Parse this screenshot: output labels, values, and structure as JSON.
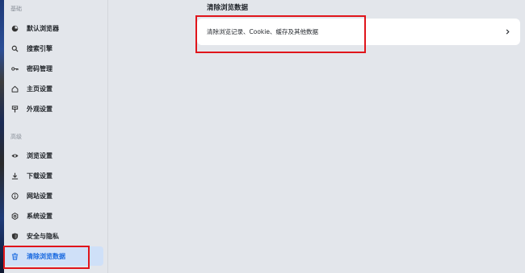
{
  "sidebar": {
    "sections": [
      {
        "title": "基础",
        "items": [
          {
            "label": "默认浏览器",
            "icon": "browser-icon"
          },
          {
            "label": "搜索引擎",
            "icon": "search-icon"
          },
          {
            "label": "密码管理",
            "icon": "key-icon"
          },
          {
            "label": "主页设置",
            "icon": "home-icon"
          },
          {
            "label": "外观设置",
            "icon": "appearance-icon"
          }
        ]
      },
      {
        "title": "高级",
        "items": [
          {
            "label": "浏览设置",
            "icon": "eye-icon"
          },
          {
            "label": "下载设置",
            "icon": "download-icon"
          },
          {
            "label": "网站设置",
            "icon": "info-icon"
          },
          {
            "label": "系统设置",
            "icon": "gear-icon"
          },
          {
            "label": "安全与隐私",
            "icon": "shield-icon"
          },
          {
            "label": "清除浏览数据",
            "icon": "trash-icon",
            "active": true
          }
        ]
      }
    ]
  },
  "main": {
    "heading": "清除浏览数据",
    "rows": [
      {
        "label": "清除浏览记录、Cookie、缓存及其他数据",
        "icon": "chevron-right-icon"
      }
    ]
  },
  "colors": {
    "accent": "#1a6ae0",
    "active_bg": "#cfe0f8",
    "annotation": "#e0151b",
    "background": "#e3e6eb"
  }
}
